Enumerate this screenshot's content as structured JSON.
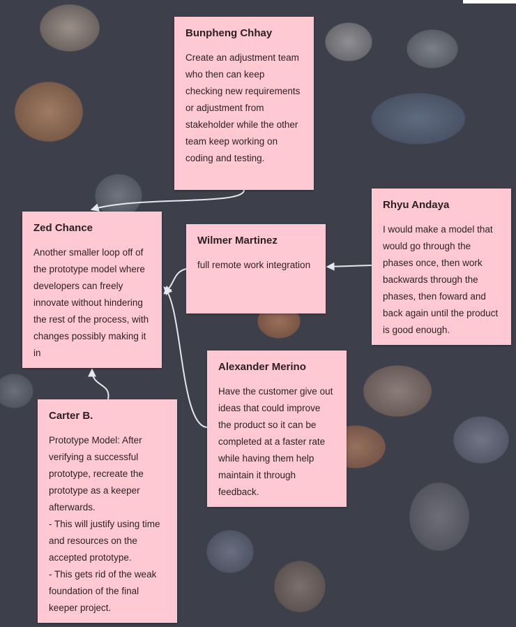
{
  "notes": [
    {
      "id": "bunpheng",
      "author": "Bunpheng Chhay",
      "text": "Create an adjustment team who then can keep checking new requirements or adjustment from stakeholder while the other team keep working on coding and testing."
    },
    {
      "id": "zed",
      "author": "Zed Chance",
      "text": "Another smaller loop off of the prototype model where developers can freely innovate without hindering the rest of the process, with changes possibly making it in"
    },
    {
      "id": "wilmer",
      "author": "Wilmer Martinez",
      "text": "full remote work integration"
    },
    {
      "id": "rhyu",
      "author": "Rhyu Andaya",
      "text": "I would make a model that would go through the phases once, then work backwards through the phases, then foward and back again until the product is good enough."
    },
    {
      "id": "alexander",
      "author": "Alexander Merino",
      "text": "Have the customer give out ideas that could improve the product so it can be completed at a faster rate while having them help maintain it through feedback."
    },
    {
      "id": "carter",
      "author": "Carter B.",
      "text": "Prototype Model: After verifying a successful prototype, recreate the prototype as a keeper afterwards.\n- This will justify using time and resources on the accepted prototype.\n- This gets rid of the weak foundation of the final keeper project."
    }
  ],
  "colors": {
    "note_background": "#ffc9d3",
    "connector": "#e6e8ee",
    "text": "#2b1f22"
  }
}
